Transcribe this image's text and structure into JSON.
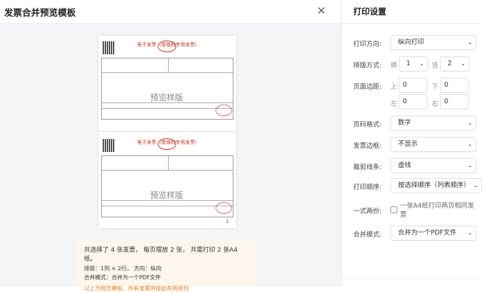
{
  "dialog": {
    "title": "发票合并预览模板",
    "close_icon": "close-icon"
  },
  "preview": {
    "invoice_title": "电子发票（增值税专用发票）",
    "watermark": "预览样版",
    "page_number": "1",
    "invoice_count": 2
  },
  "summary": {
    "line1": "共选择了 4 张发票， 每页摆放 2 张， 共需打印 2 张A4纸。",
    "line2": "排版：1列 × 2行， 方向：纵向",
    "line3": "合并模式：合并为一个PDF文件",
    "note": "以上为预览模板，所有发票将按此布局排列"
  },
  "settings": {
    "title": "打印设置",
    "orientation": {
      "label": "打印方向:",
      "value": "纵向打印"
    },
    "layout": {
      "label": "排版方式:",
      "h_label": "横",
      "h_value": "1",
      "v_label": "竖",
      "v_value": "2"
    },
    "margin": {
      "label": "页面边距:",
      "top_label": "上",
      "top": "0",
      "bottom_label": "下",
      "bottom": "0",
      "left_label": "左",
      "left": "0",
      "right_label": "右",
      "right": "0"
    },
    "page_number_format": {
      "label": "页码格式:",
      "value": "数字"
    },
    "invoice_border": {
      "label": "发票边框:",
      "value": "不显示"
    },
    "cut_line": {
      "label": "裁剪线条:",
      "value": "虚线"
    },
    "print_order": {
      "label": "打印顺序:",
      "value": "按选择顺序（列表顺序）"
    },
    "duplicate": {
      "label": "一式两份:",
      "checkbox_label": "一张A4纸打印两页相同发票",
      "checked": false
    },
    "merge_mode": {
      "label": "合并模式:",
      "value": "合并为一个PDF文件"
    }
  }
}
